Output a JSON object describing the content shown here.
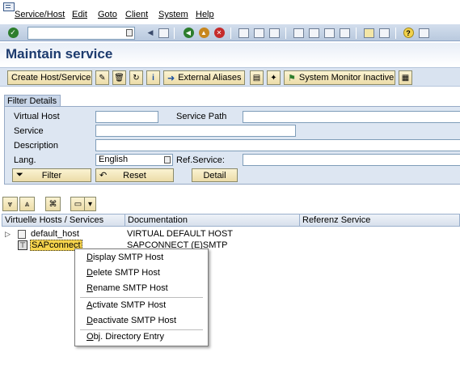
{
  "menubar": {
    "items": [
      "Service/Host",
      "Edit",
      "Goto",
      "Client",
      "System",
      "Help"
    ]
  },
  "page": {
    "title": "Maintain service"
  },
  "app_toolbar": {
    "create_label": "Create Host/Service",
    "external_aliases_label": "External Aliases",
    "system_monitor_label": "System Monitor Inactive"
  },
  "filter": {
    "tab_label": "Filter Details",
    "virtual_host_label": "Virtual Host",
    "virtual_host_value": "",
    "service_path_label": "Service Path",
    "service_path_value": "",
    "service_label": "Service",
    "service_value": "",
    "description_label": "Description",
    "description_value": "",
    "lang_label": "Lang.",
    "lang_value": "English",
    "ref_service_label": "Ref.Service:",
    "ref_service_value": "",
    "filter_button": "Filter",
    "reset_button": "Reset",
    "detail_button": "Detail"
  },
  "tree": {
    "columns": [
      "Virtuelle Hosts / Services",
      "Documentation",
      "Referenz Service"
    ],
    "rows": [
      {
        "name": "default_host",
        "doc": "VIRTUAL DEFAULT HOST",
        "ref": ""
      },
      {
        "name": "SAPconnect",
        "doc": "SAPCONNECT (E)SMTP",
        "ref": ""
      }
    ]
  },
  "context_menu": {
    "items": [
      {
        "mnemonic": "D",
        "rest": "isplay SMTP Host"
      },
      {
        "mnemonic": "D",
        "rest": "elete SMTP Host"
      },
      {
        "mnemonic": "R",
        "rest": "ename SMTP Host"
      },
      {
        "mnemonic": "A",
        "rest": "ctivate SMTP Host"
      },
      {
        "mnemonic": "D",
        "rest": "eactivate SMTP Host"
      },
      {
        "mnemonic": "O",
        "rest": "bj. Directory Entry"
      }
    ]
  },
  "colors": {
    "title": "#1d3b6e",
    "button_fill": "#ecdca8",
    "panel_bg": "#dde6f2",
    "selected_node": "#f6d34c"
  }
}
